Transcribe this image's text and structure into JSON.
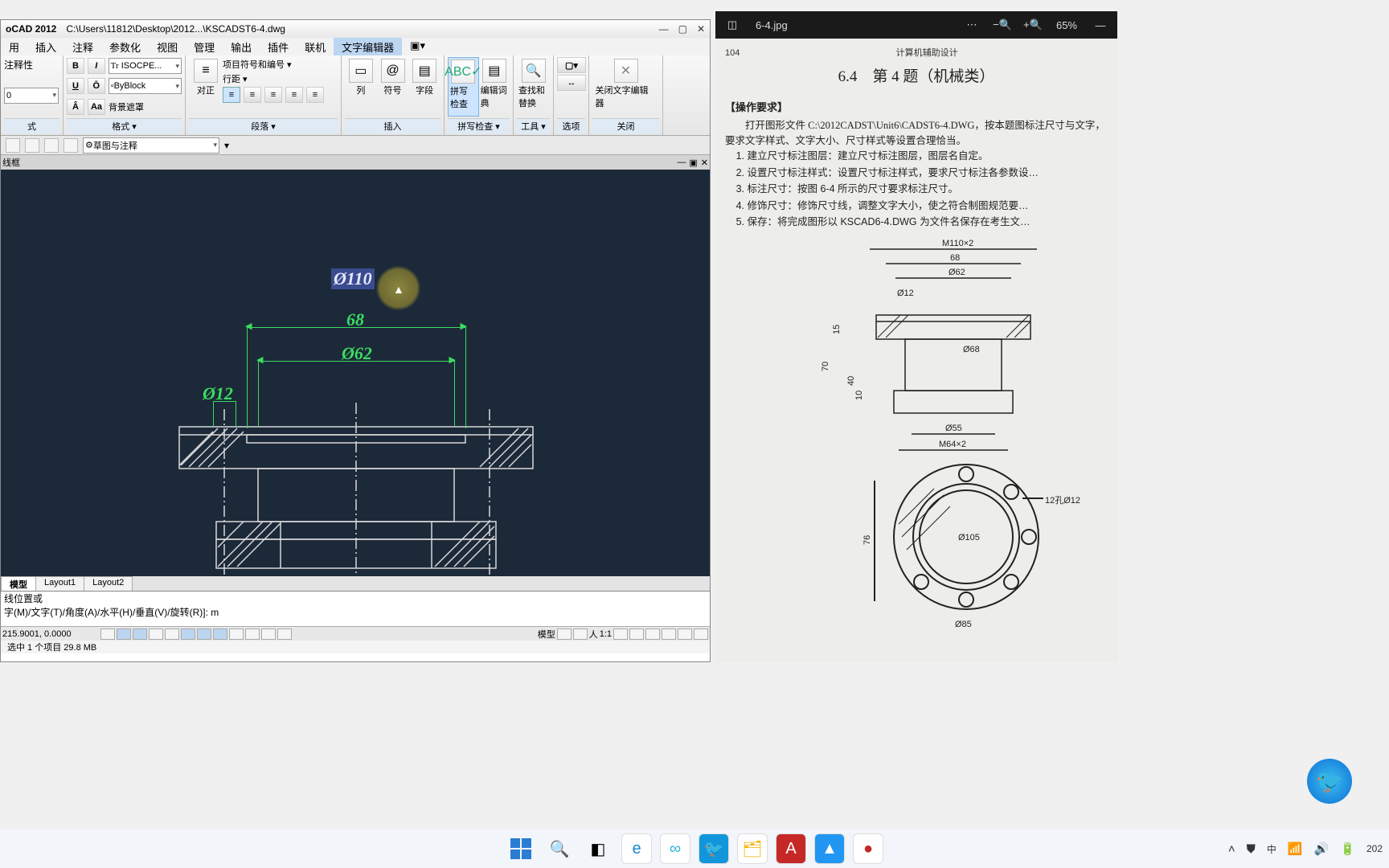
{
  "cad": {
    "app": "oCAD 2012",
    "doc_path": "C:\\Users\\11812\\Desktop\\2012...\\KSCADST6-4.dwg",
    "menu": [
      "用",
      "插入",
      "注释",
      "参数化",
      "视图",
      "管理",
      "输出",
      "插件",
      "联机",
      "文字编辑器"
    ],
    "ribbon": {
      "style_label": "注释性",
      "font_combo": "ISOCPE...",
      "color_combo": "ByBlock",
      "mask": "背景遮罩",
      "panel_style": "式",
      "panel_format": "格式 ▾",
      "justify": "对正",
      "bullets": "项目符号和编号 ▾",
      "linespacing": "行距 ▾",
      "panel_paragraph": "段落 ▾",
      "columns": "列",
      "symbol": "符号",
      "field": "字段",
      "panel_insert": "插入",
      "spellcheck": "拼写检查",
      "dict": "编辑词典",
      "panel_spell": "拼写检查 ▾",
      "findrep": "查找和替换",
      "panel_tools": "工具 ▾",
      "panel_options": "选项",
      "close_editor": "关闭文字编辑器",
      "panel_close": "关闭"
    },
    "qat_workspace": "草图与注释",
    "docbar": "线框",
    "dims": {
      "editing": "Ø110",
      "d68": "68",
      "d62": "Ø62",
      "d12": "Ø12"
    },
    "tabs": {
      "model": "模型",
      "l1": "Layout1",
      "l2": "Layout2"
    },
    "cmd_line1": "线位置或",
    "cmd_line2": "字(M)/文字(T)/角度(A)/水平(H)/垂直(V)/旋转(R)]: m",
    "status_coords": "215.9001, 0.0000",
    "status_model": "模型",
    "status_scale": "1:1",
    "status2": "选中 1 个项目   29.8 MB"
  },
  "viewer": {
    "filename": "6-4.jpg",
    "zoom": "65%",
    "page_num": "104",
    "page_head": "计算机辅助设计",
    "title": "6.4　第 4 题（机械类）",
    "req_head": "【操作要求】",
    "intro": "打开图形文件 C:\\2012CADST\\Unit6\\CADST6-4.DWG，按本题图标注尺寸与文字，要求文字样式、文字大小、尺寸样式等设置合理恰当。",
    "list": [
      "建立尺寸标注图层：建立尺寸标注图层，图层名自定。",
      "设置尺寸标注样式：设置尺寸标注样式，要求尺寸标注各参数设…",
      "标注尺寸：按图 6-4 所示的尺寸要求标注尺寸。",
      "修饰尺寸：修饰尺寸线，调整文字大小，使之符合制图规范要…",
      "保存：将完成图形以 KSCAD6-4.DWG 为文件名保存在考生文…"
    ],
    "fig_dims": {
      "m110": "M110×2",
      "d68b": "68",
      "d62b": "Ø62",
      "d12b": "Ø12",
      "d68c": "Ø68",
      "d55": "Ø55",
      "m64": "M64×2",
      "h15": "15",
      "h70": "70",
      "h40": "40",
      "h10": "10",
      "d105": "Ø105",
      "d85": "Ø85",
      "holes": "12孔Ø12",
      "h76": "76"
    }
  },
  "tray": {
    "ime": "中",
    "year": "202"
  }
}
